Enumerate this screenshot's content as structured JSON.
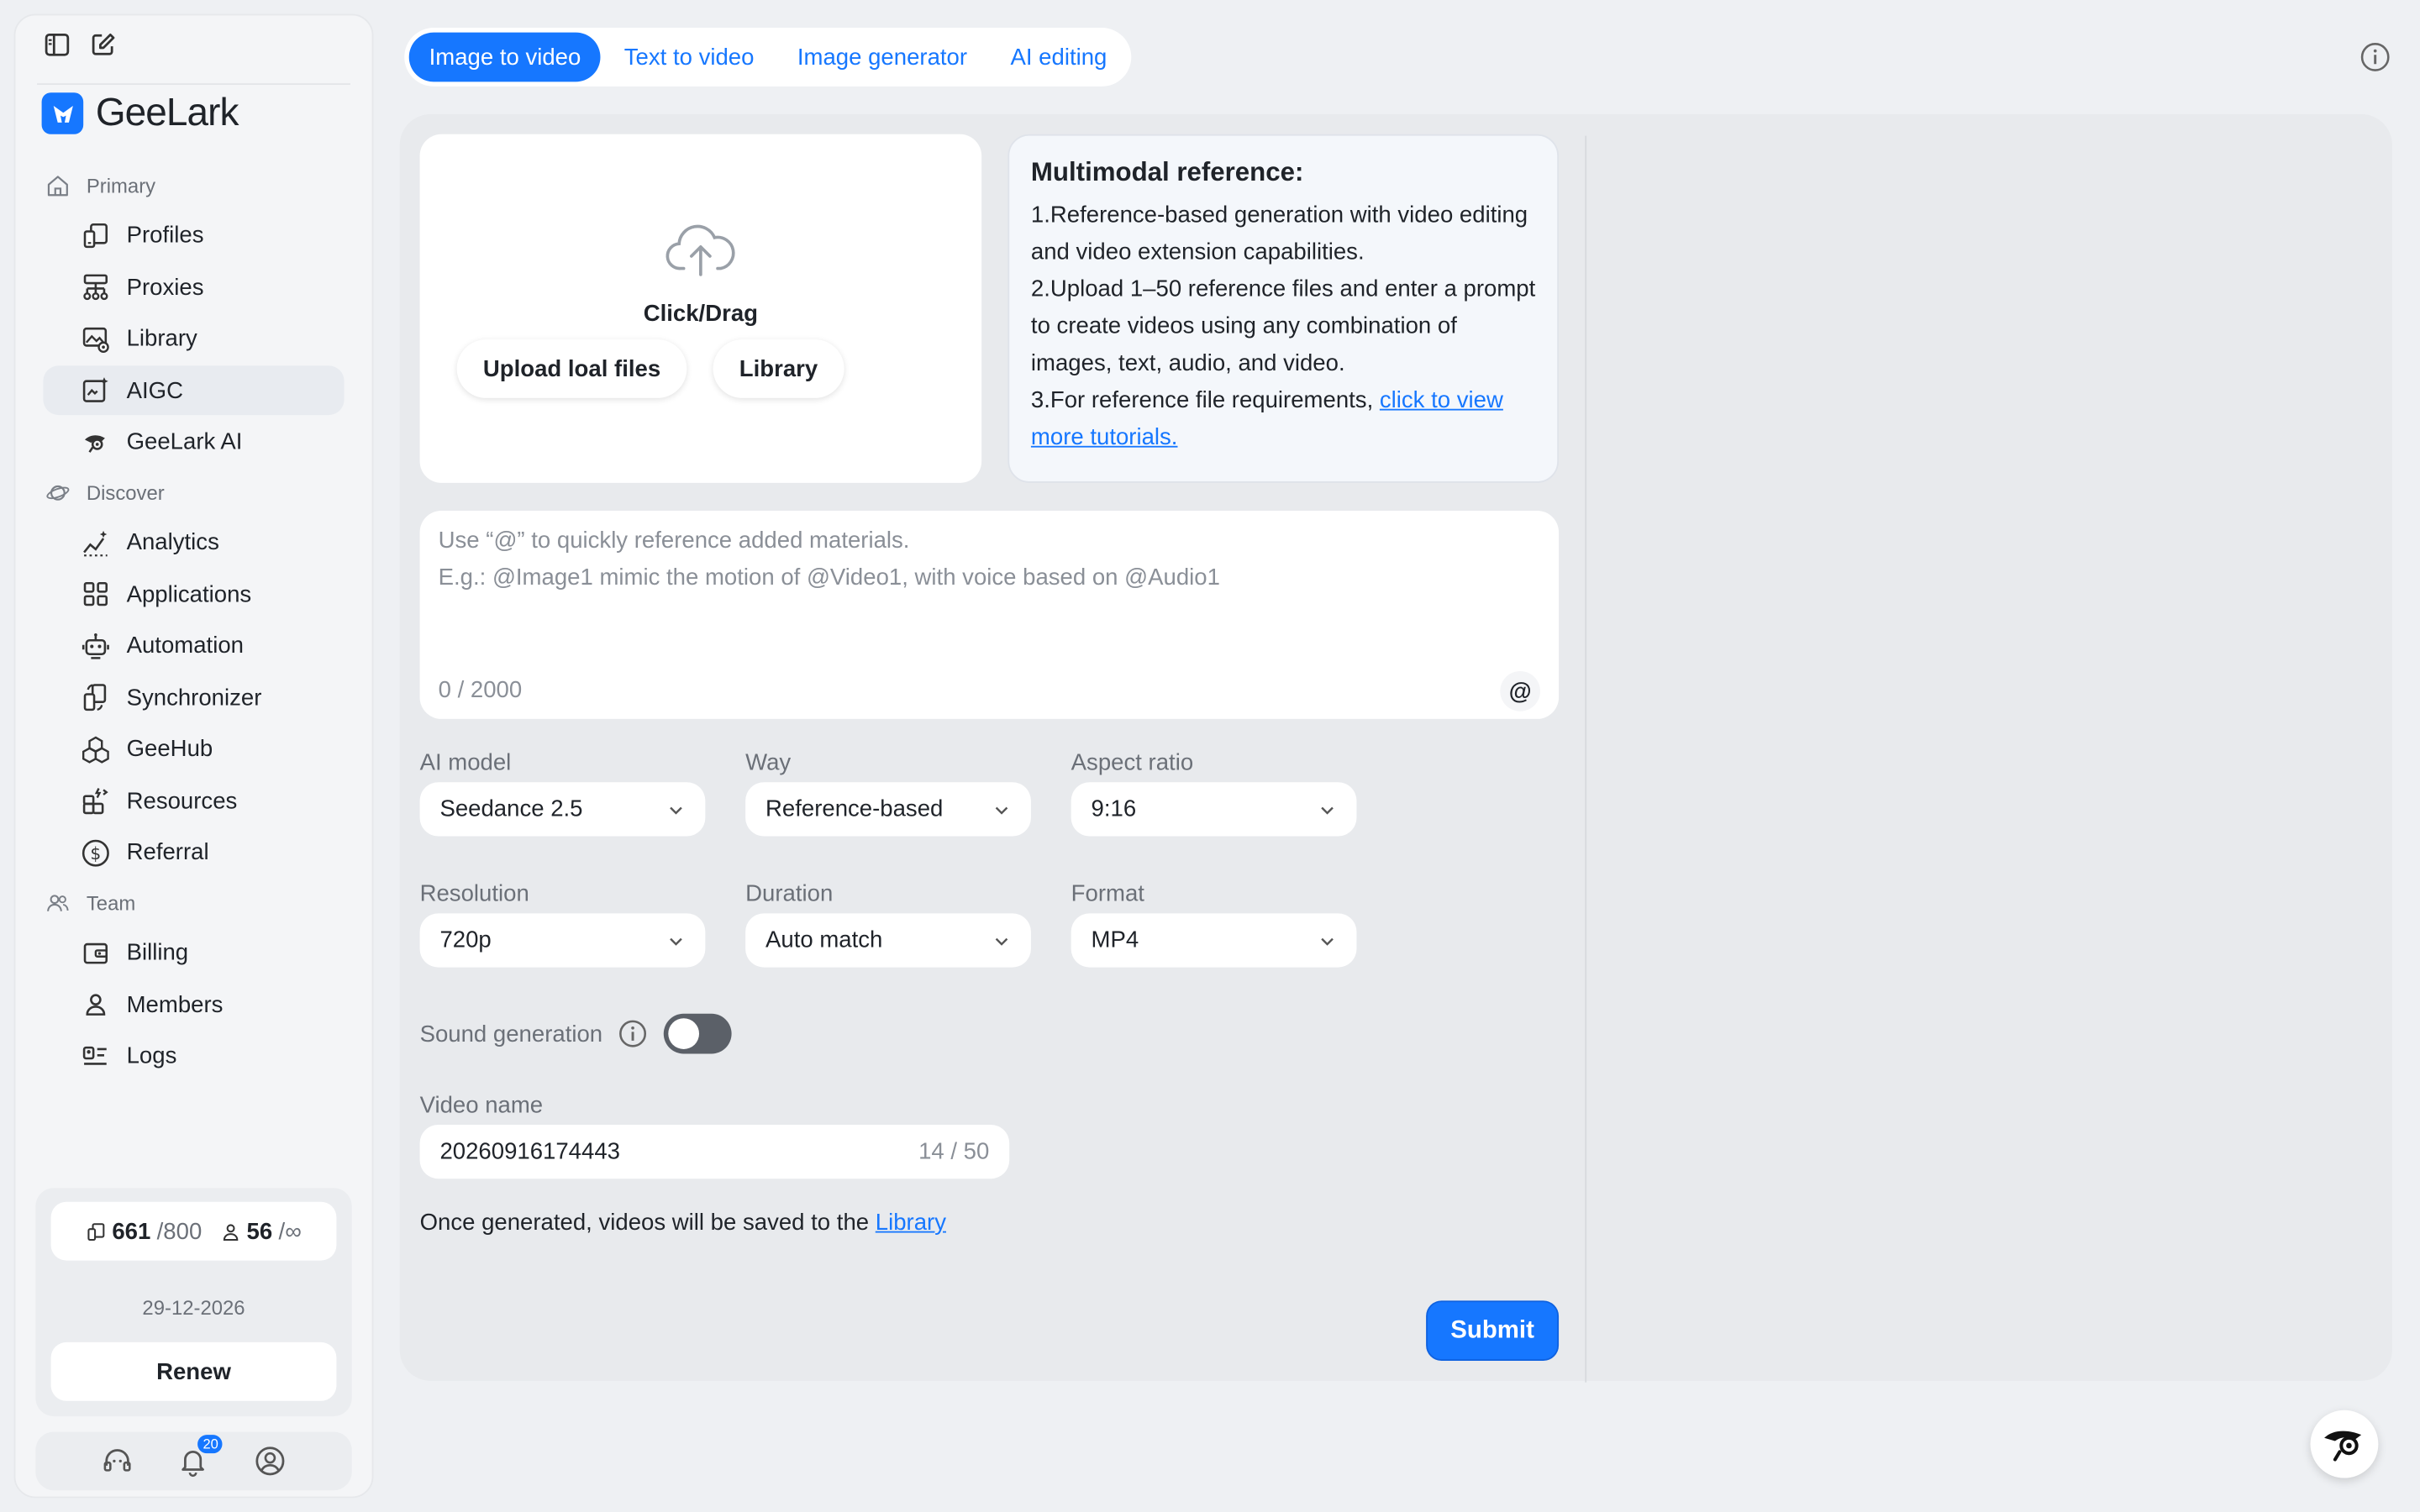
{
  "brand": {
    "name": "GeeLark",
    "accent": "#1677ff"
  },
  "nav": {
    "primary_label": "Primary",
    "primary_items": [
      {
        "label": "Profiles",
        "icon": "profiles-icon"
      },
      {
        "label": "Proxies",
        "icon": "proxies-icon"
      },
      {
        "label": "Library",
        "icon": "library-icon"
      },
      {
        "label": "AIGC",
        "icon": "aigc-icon",
        "active": true
      },
      {
        "label": "GeeLark AI",
        "icon": "geelark-ai-icon"
      }
    ],
    "discover_label": "Discover",
    "discover_items": [
      {
        "label": "Analytics",
        "icon": "analytics-icon"
      },
      {
        "label": "Applications",
        "icon": "applications-icon"
      },
      {
        "label": "Automation",
        "icon": "robot-icon"
      },
      {
        "label": "Synchronizer",
        "icon": "synchronizer-icon"
      },
      {
        "label": "GeeHub",
        "icon": "geehub-icon"
      },
      {
        "label": "Resources",
        "icon": "resources-icon"
      },
      {
        "label": "Referral",
        "icon": "dollar-icon"
      }
    ],
    "team_label": "Team",
    "team_items": [
      {
        "label": "Billing",
        "icon": "wallet-icon"
      },
      {
        "label": "Members",
        "icon": "user-icon"
      },
      {
        "label": "Logs",
        "icon": "logs-icon"
      }
    ]
  },
  "quota": {
    "profiles_used": "661",
    "profiles_total": "/800",
    "members_used": "56",
    "members_total": "/∞",
    "expiry": "29-12-2026",
    "renew_label": "Renew",
    "notifications_count": "20"
  },
  "tabs": [
    {
      "label": "Image to video",
      "active": true
    },
    {
      "label": "Text to video"
    },
    {
      "label": "Image generator"
    },
    {
      "label": "AI editing"
    }
  ],
  "upload": {
    "title": "Click/Drag",
    "upload_button": "Upload loal files",
    "library_button": "Library"
  },
  "info": {
    "heading": "Multimodal reference:",
    "line1": "1.Reference-based generation with video editing and video extension capabilities.",
    "line2": "2.Upload 1–50 reference files and enter a prompt to create videos using any combination of images, text, audio, and video.",
    "line3_prefix": "3.For reference file requirements, ",
    "line3_link": "click to view more tutorials."
  },
  "prompt": {
    "placeholder_line1": "Use “@” to quickly reference added materials.",
    "placeholder_line2": "E.g.: @Image1 mimic the motion of @Video1, with voice based on @Audio1",
    "counter": "0 / 2000",
    "at_label": "@"
  },
  "settings": {
    "ai_model": {
      "label": "AI model",
      "value": "Seedance 2.5"
    },
    "way": {
      "label": "Way",
      "value": "Reference-based"
    },
    "aspect_ratio": {
      "label": "Aspect ratio",
      "value": "9:16"
    },
    "resolution": {
      "label": "Resolution",
      "value": "720p"
    },
    "duration": {
      "label": "Duration",
      "value": "Auto match"
    },
    "format": {
      "label": "Format",
      "value": "MP4"
    }
  },
  "sound": {
    "label": "Sound generation",
    "enabled": false
  },
  "video_name": {
    "label": "Video name",
    "value": "20260916174443",
    "counter": "14 / 50"
  },
  "save_note": {
    "prefix": "Once generated, videos will be saved to the ",
    "link": "Library"
  },
  "submit_label": "Submit"
}
